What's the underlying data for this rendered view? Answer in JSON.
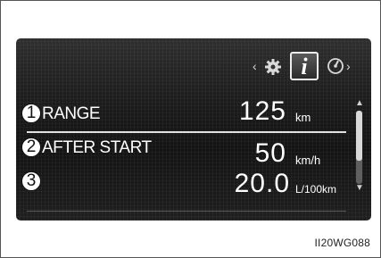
{
  "display": {
    "nav": {
      "left_arrow": "‹",
      "right_arrow": "›",
      "info_glyph": "i",
      "icons": [
        "gear-icon",
        "info-icon",
        "gauge-icon"
      ],
      "selected": "info-icon"
    },
    "rows": [
      {
        "callout": "1",
        "label": "RANGE",
        "value": "125",
        "unit": "km"
      },
      {
        "callout": "2",
        "label": "AFTER START",
        "value": "50",
        "unit": "km/h"
      },
      {
        "callout": "3",
        "label": "",
        "value": "20.0",
        "unit": "L/100km"
      }
    ],
    "scrollbar": {
      "up": "▲",
      "down": "▼"
    }
  },
  "figure_code": "II20WG088",
  "colors": {
    "screen_background": "#1c1c1c",
    "text": "#ffffff",
    "page_background": "#ffffff"
  }
}
